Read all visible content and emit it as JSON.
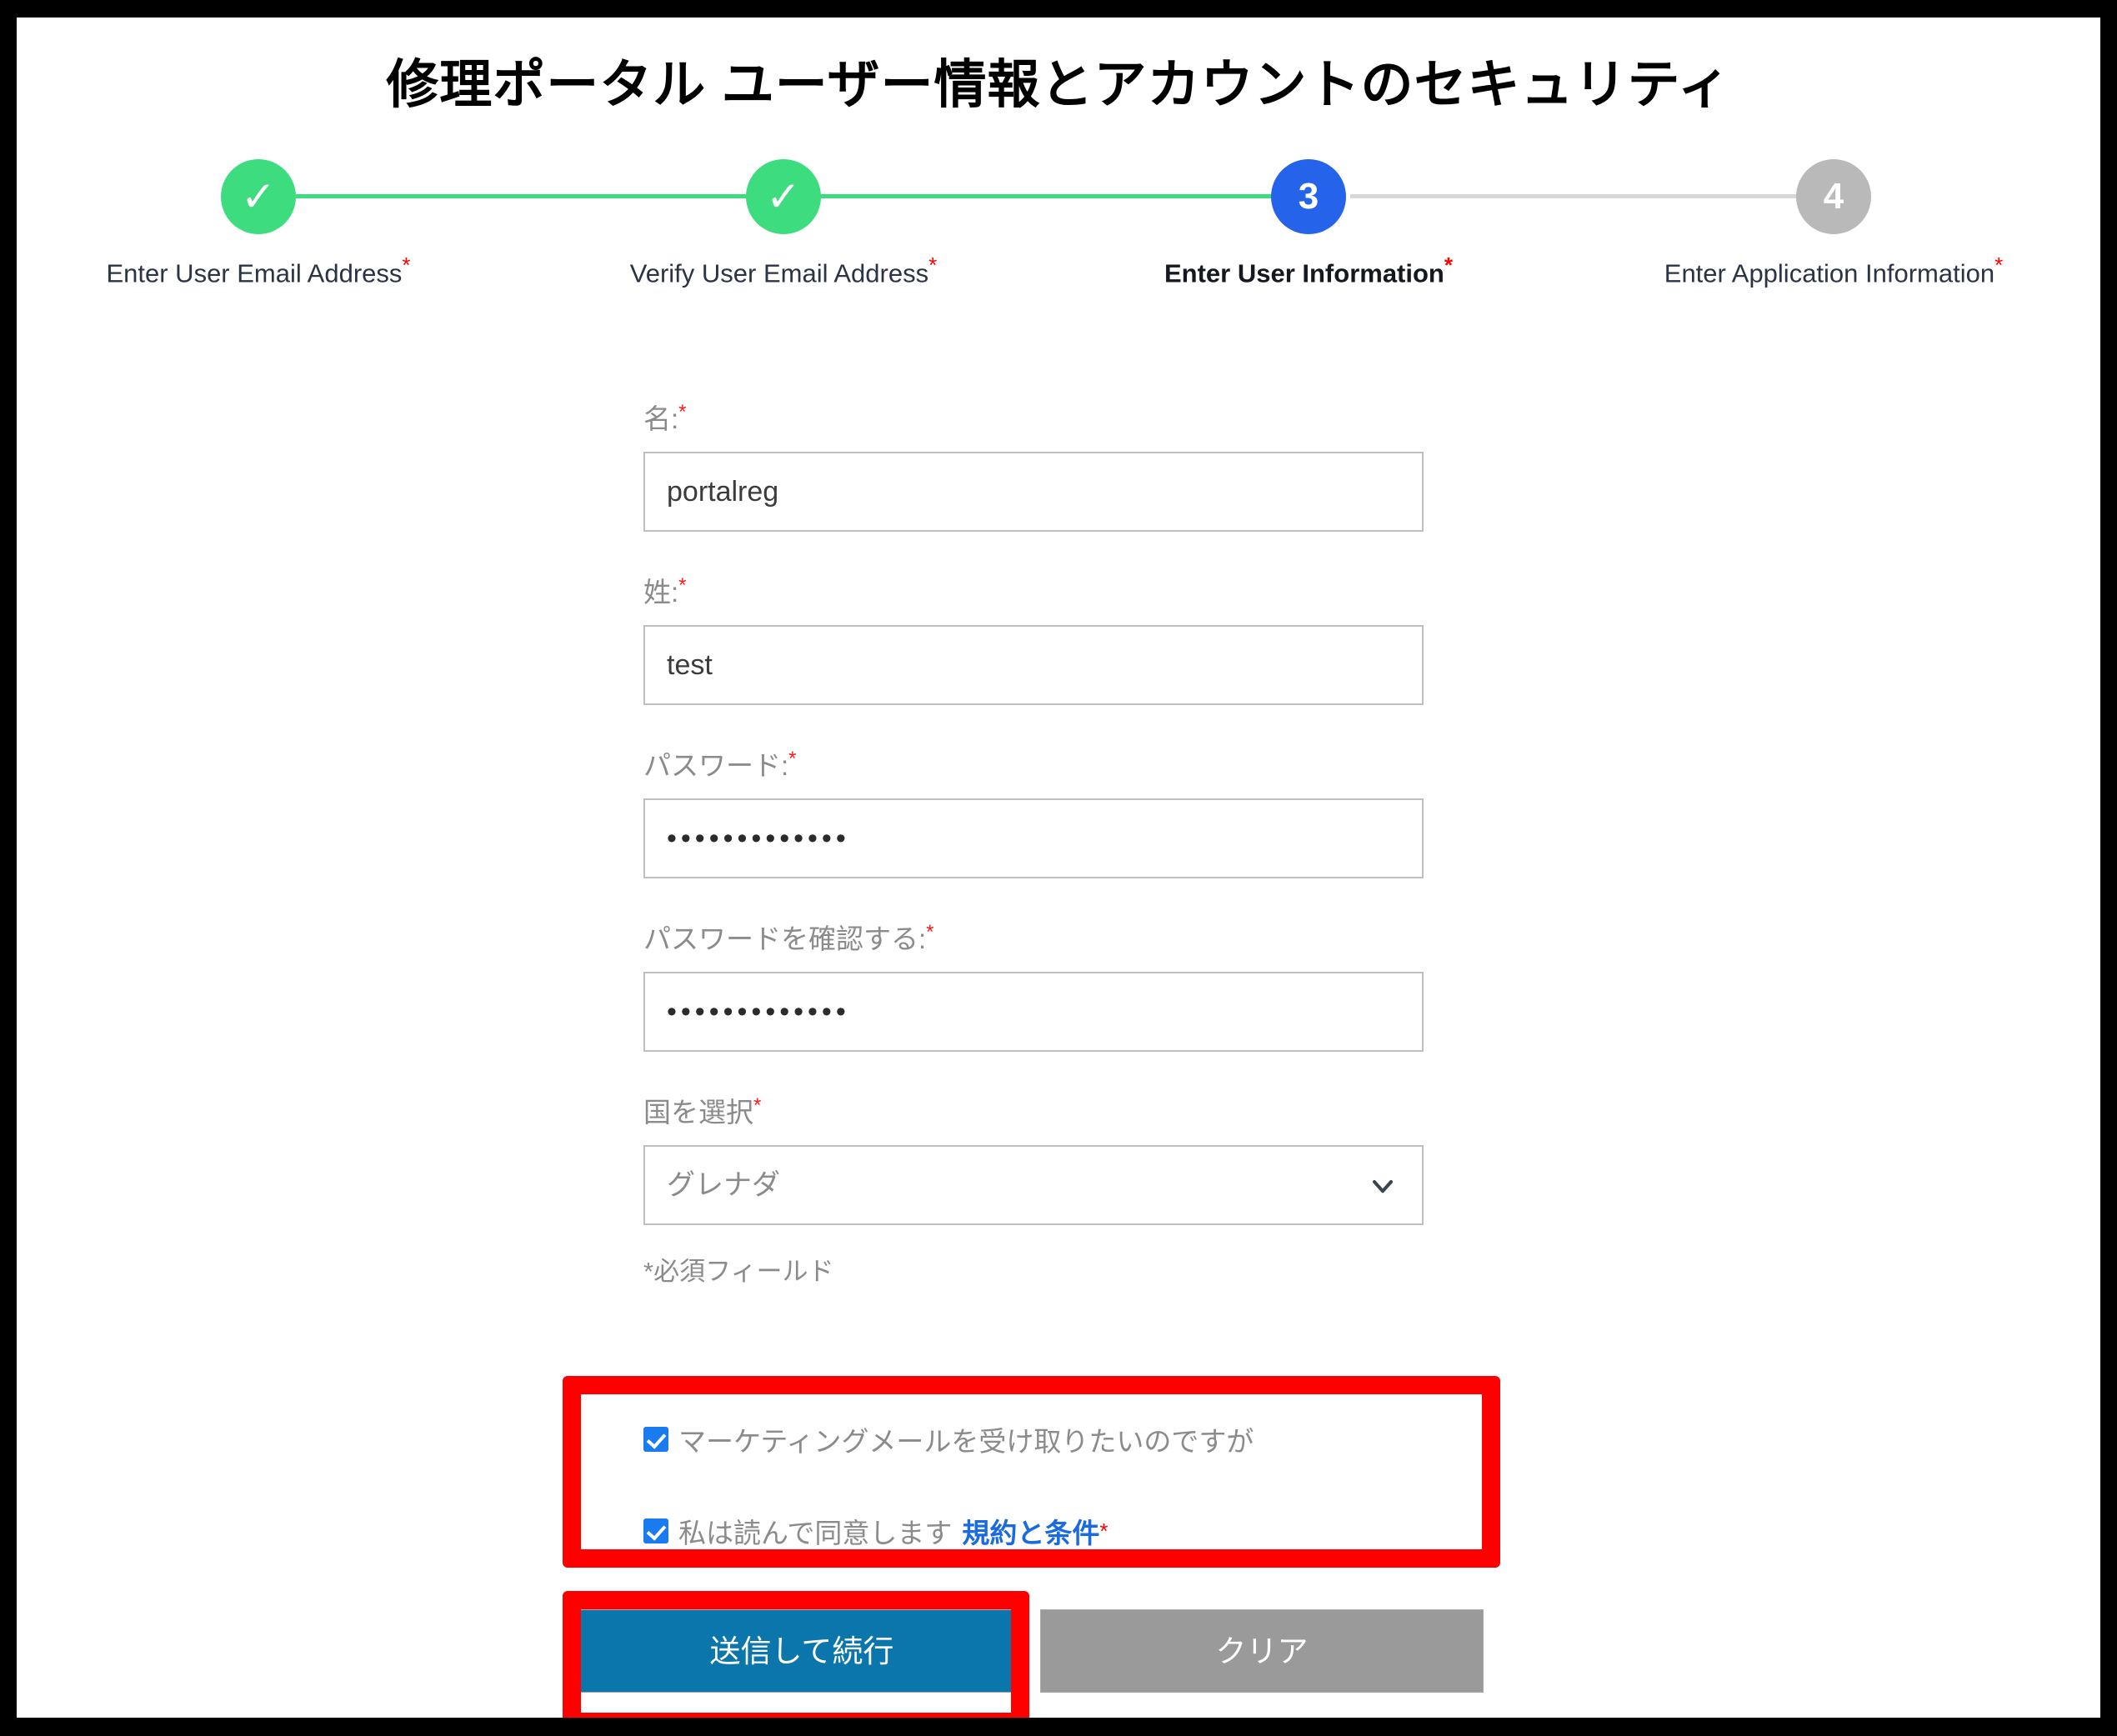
{
  "page": {
    "title": "修理ポータル ユーザー情報とアカウントのセキュリティ"
  },
  "stepper": {
    "steps": [
      {
        "marker": "✓",
        "label": "Enter User Email Address",
        "state": "done",
        "required": "*"
      },
      {
        "marker": "✓",
        "label": "Verify User Email Address",
        "state": "done",
        "required": "*"
      },
      {
        "marker": "3",
        "label": "Enter User Information",
        "state": "active",
        "required": "*"
      },
      {
        "marker": "4",
        "label": "Enter Application Information",
        "state": "todo",
        "required": "*"
      }
    ]
  },
  "form": {
    "first_name": {
      "label": "名:",
      "required": "*",
      "value": "portalreg",
      "placeholder": "名"
    },
    "last_name": {
      "label": "姓:",
      "required": "*",
      "value": "test",
      "placeholder": "姓"
    },
    "password": {
      "label": "パスワード:",
      "required": "*",
      "value": "•••••••••••••",
      "placeholder": "パスワード"
    },
    "confirm_password": {
      "label": "パスワードを確認する:",
      "required": "*",
      "value": "•••••••••••••",
      "placeholder": "パスワードを確認する"
    },
    "country": {
      "label": "国を選択",
      "required": "*",
      "value": "グレナダ",
      "icon": "chevron-down-icon"
    },
    "required_note": "*必須フィールド"
  },
  "checkboxes": {
    "marketing": {
      "label": "マーケティングメールを受け取りたいのですが",
      "checked": true
    },
    "terms": {
      "label": "私は読んで同意します",
      "link_label": "規約と条件",
      "required": "*",
      "checked": true
    }
  },
  "buttons": {
    "submit": "送信して続行",
    "clear": "クリア"
  },
  "colors": {
    "step_done": "#3ddc7f",
    "step_active": "#2563eb",
    "step_todo": "#b9b9b9",
    "submit_button": "#0b76ab",
    "clear_button": "#9a9a9a",
    "checkbox": "#1a7af0",
    "link": "#1a6ae0",
    "required_star": "#ff0000",
    "annotation": "#ff0000"
  }
}
